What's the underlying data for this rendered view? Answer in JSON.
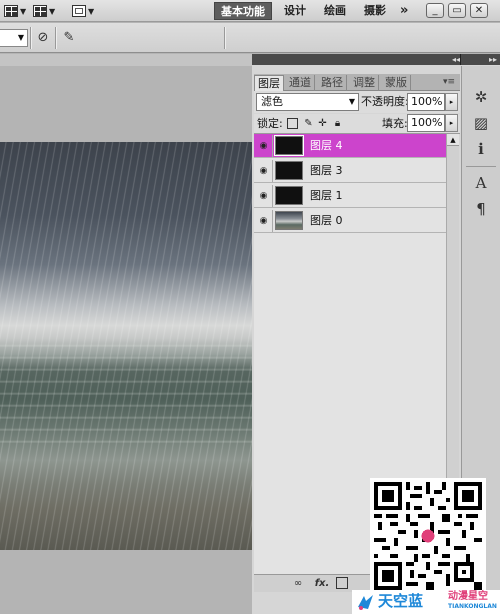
{
  "menubar": {
    "workspaces": [
      "基本功能",
      "设计",
      "绘画",
      "摄影"
    ],
    "more": "»",
    "window_buttons": [
      "_",
      "▭",
      "✕"
    ]
  },
  "panel": {
    "tabs": [
      "图层",
      "通道",
      "路径",
      "调整",
      "蒙版"
    ],
    "menu_icon": "▾≡",
    "blend_mode": "滤色",
    "opacity_label": "不透明度:",
    "opacity_value": "100%",
    "lock_label": "锁定:",
    "fill_label": "填充:",
    "fill_value": "100%",
    "layers": [
      {
        "name": "图层 4",
        "selected": true
      },
      {
        "name": "图层 3",
        "selected": false
      },
      {
        "name": "图层 1",
        "selected": false
      },
      {
        "name": "图层 0",
        "selected": false
      }
    ],
    "bottom_icons": [
      "link-icon",
      "fx-icon",
      "mask-icon"
    ]
  },
  "side_panel_icons": [
    "navigator-icon",
    "histogram-icon",
    "info-icon",
    "character-icon",
    "paragraph-icon"
  ],
  "watermark": {
    "main": "天空蓝",
    "sub": "动漫星空",
    "en": "TIANKONGLAN"
  },
  "colors": {
    "selected_layer": "#cc44cc",
    "logo_blue": "#1e88d8",
    "logo_pink": "#e0407a"
  }
}
